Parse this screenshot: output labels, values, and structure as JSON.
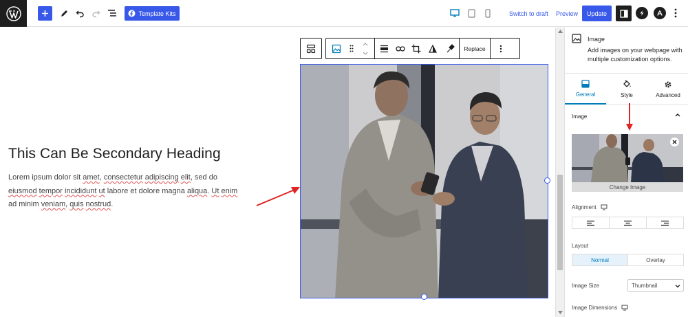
{
  "toolbar": {
    "template_kits_label": "Template Kits",
    "switch_to_draft": "Switch to draft",
    "preview": "Preview",
    "update": "Update"
  },
  "content": {
    "heading": "This Can Be Secondary Heading",
    "paragraph_segments": [
      {
        "text": "Lorem ipsum dolor sit ",
        "spell": false
      },
      {
        "text": "amet",
        "spell": true
      },
      {
        "text": ", ",
        "spell": false
      },
      {
        "text": "consectetur",
        "spell": true
      },
      {
        "text": " ",
        "spell": false
      },
      {
        "text": "adipiscing",
        "spell": true
      },
      {
        "text": " ",
        "spell": false
      },
      {
        "text": "elit",
        "spell": true
      },
      {
        "text": ", sed do ",
        "spell": false
      },
      {
        "text": "eiusmod",
        "spell": true
      },
      {
        "text": " ",
        "spell": false
      },
      {
        "text": "tempor",
        "spell": true
      },
      {
        "text": " ",
        "spell": false
      },
      {
        "text": "incididunt",
        "spell": true
      },
      {
        "text": " ",
        "spell": false
      },
      {
        "text": "ut",
        "spell": true
      },
      {
        "text": " labore et dolore magna ",
        "spell": false
      },
      {
        "text": "aliqua",
        "spell": true
      },
      {
        "text": ". ",
        "spell": false
      },
      {
        "text": "Ut",
        "spell": true
      },
      {
        "text": " ",
        "spell": false
      },
      {
        "text": "enim",
        "spell": true
      },
      {
        "text": " ad minim ",
        "spell": false
      },
      {
        "text": "veniam",
        "spell": true
      },
      {
        "text": ", ",
        "spell": false
      },
      {
        "text": "quis",
        "spell": true
      },
      {
        "text": " ",
        "spell": false
      },
      {
        "text": "nostrud",
        "spell": true
      },
      {
        "text": ".",
        "spell": false
      }
    ]
  },
  "block_toolbar": {
    "replace": "Replace"
  },
  "sidebar": {
    "block_title": "Image",
    "block_description": "Add images on your webpage with multiple customization options.",
    "tabs": [
      {
        "label": "General",
        "icon": "general-icon",
        "active": true
      },
      {
        "label": "Style",
        "icon": "paint-bucket-icon",
        "active": false
      },
      {
        "label": "Advanced",
        "icon": "gear-icon",
        "active": false
      }
    ],
    "image_section_title": "Image",
    "change_image": "Change Image",
    "alignment_label": "Alignment",
    "layout_label": "Layout",
    "layout_options": [
      "Normal",
      "Overlay"
    ],
    "layout_selected": "Normal",
    "image_size_label": "Image Size",
    "image_size_value": "Thumbnail",
    "image_dimensions_label": "Image Dimensions"
  },
  "colors": {
    "accent": "#3858e9",
    "wp_blue": "#007cba",
    "annotation_red": "#e02424"
  }
}
